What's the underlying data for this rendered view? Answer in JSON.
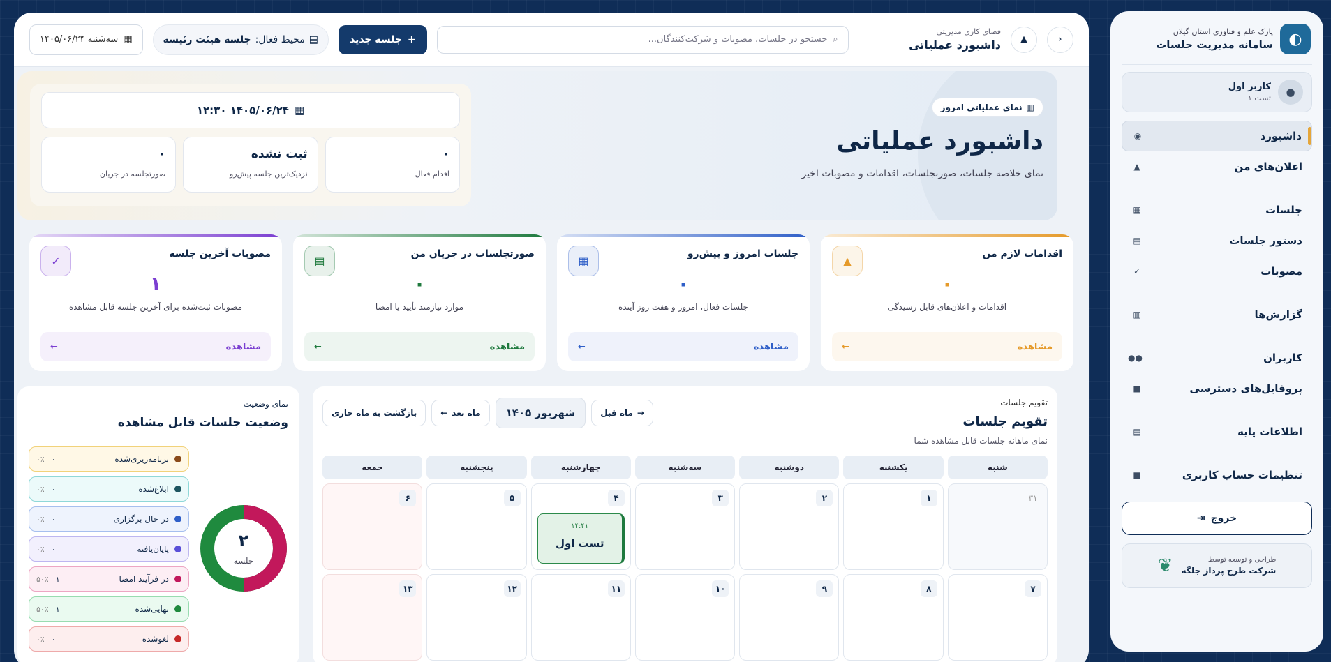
{
  "sidebar": {
    "brand_sub": "پارک علم و فناوری استان گیلان",
    "brand_title": "سامانه مدیریت جلسات",
    "user_name": "کاربر اول",
    "user_sub": "تست ۱",
    "items": [
      {
        "label": "داشبورد",
        "icon": "eye-icon"
      },
      {
        "label": "اعلان‌های من",
        "icon": "bell-icon"
      },
      {
        "label": "جلسات",
        "icon": "calendar-icon"
      },
      {
        "label": "دستور جلسات",
        "icon": "document-icon"
      },
      {
        "label": "مصوبات",
        "icon": "check-icon"
      },
      {
        "label": "گزارش‌ها",
        "icon": "chart-icon"
      },
      {
        "label": "کاربران",
        "icon": "users-icon"
      },
      {
        "label": "پروفایل‌های دسترسی",
        "icon": "lock-icon"
      },
      {
        "label": "اطلاعات پایه",
        "icon": "document-icon"
      },
      {
        "label": "تنظیمات حساب کاربری",
        "icon": "lock-icon"
      }
    ],
    "logout_label": "خروج",
    "dev_sub": "طراحی و توسعه توسط",
    "dev_title": "شرکت طرح پرداز جلگه"
  },
  "topbar": {
    "ws_sub": "فضای کاری مدیریتی",
    "ws_title": "داشبورد عملیاتی",
    "search_placeholder": "جستجو در جلسات، مصوبات و شرکت‌کنندگان...",
    "new_button": "جلسه جدید",
    "env_label": "محیط فعال:",
    "env_value": "جلسه هیئت رئیسه",
    "date": "سه‌شنبه ۱۴۰۵/۰۶/۲۴"
  },
  "hero": {
    "pill": "نمای عملیاتی امروز",
    "title": "داشبورد عملیاتی",
    "desc": "نمای خلاصه جلسات، صورتجلسات، اقدامات و مصوبات اخیر",
    "datetime": "۱۴۰۵/۰۶/۲۴ ۱۲:۳۰",
    "stats": [
      {
        "value": "۰",
        "label": "اقدام فعال"
      },
      {
        "value": "ثبت نشده",
        "label": "نزدیک‌ترین جلسه پیش‌رو"
      },
      {
        "value": "۰",
        "label": "صورتجلسه در جریان"
      }
    ]
  },
  "cards": [
    {
      "title": "اقدامات لازم من",
      "value": "۰",
      "desc": "اقدامات و اعلان‌های قابل رسیدگی",
      "link": "مشاهده",
      "color": "#e59a2a",
      "icon": "bell-icon"
    },
    {
      "title": "جلسات امروز و پیش‌رو",
      "value": "۰",
      "desc": "جلسات فعال، امروز و هفت روز آینده",
      "link": "مشاهده",
      "color": "#2f5fc8",
      "icon": "calendar-icon"
    },
    {
      "title": "صورتجلسات در جریان من",
      "value": "۰",
      "desc": "موارد نیازمند تأیید یا امضا",
      "link": "مشاهده",
      "color": "#1f7a3e",
      "icon": "document-icon"
    },
    {
      "title": "مصوبات آخرین جلسه",
      "value": "۱",
      "desc": "مصوبات ثبت‌شده برای آخرین جلسه قابل مشاهده",
      "link": "مشاهده",
      "color": "#7b3fd1",
      "icon": "check-icon"
    }
  ],
  "calendar": {
    "sub": "تقویم جلسات",
    "title": "تقویم جلسات",
    "desc": "نمای ماهانه جلسات قابل مشاهده شما",
    "prev": "ماه قبل",
    "month": "شهریور ۱۴۰۵",
    "next": "ماه بعد",
    "back": "بازگشت به ماه جاری",
    "weekdays": [
      "شنبه",
      "یکشنبه",
      "دوشنبه",
      "سه‌شنبه",
      "چهارشنبه",
      "پنجشنبه",
      "جمعه"
    ],
    "rows": [
      [
        "۳۱",
        "۱",
        "۲",
        "۳",
        "۴",
        "۵",
        "۶"
      ],
      [
        "۷",
        "۸",
        "۹",
        "۱۰",
        "۱۱",
        "۱۲",
        "۱۳"
      ]
    ],
    "event": {
      "time": "۱۴:۴۱",
      "title": "تست اول"
    }
  },
  "status": {
    "sub": "نمای وضعیت",
    "title": "وضعیت جلسات قابل مشاهده",
    "total": "۲",
    "total_label": "جلسه",
    "items": [
      {
        "label": "برنامه‌ریزی‌شده",
        "count": "۰",
        "pct": "۰٪",
        "color": "#8a4a1a",
        "bg": "#fff8e6",
        "border": "#f1d27a"
      },
      {
        "label": "ابلاغ‌شده",
        "count": "۰",
        "pct": "۰٪",
        "color": "#1d5560",
        "bg": "#ecfafa",
        "border": "#8fd8d8"
      },
      {
        "label": "در حال برگزاری",
        "count": "۰",
        "pct": "۰٪",
        "color": "#2f5fc8",
        "bg": "#eef3fd",
        "border": "#a6bfee"
      },
      {
        "label": "پایان‌یافته",
        "count": "۰",
        "pct": "۰٪",
        "color": "#5a4fd8",
        "bg": "#f2f0fd",
        "border": "#bdb6f0"
      },
      {
        "label": "در فرآیند امضا",
        "count": "۱",
        "pct": "۵۰٪",
        "color": "#c2185b",
        "bg": "#fdeef4",
        "border": "#eda6c3"
      },
      {
        "label": "نهایی‌شده",
        "count": "۱",
        "pct": "۵۰٪",
        "color": "#1f8a3e",
        "bg": "#eafaf0",
        "border": "#98dcb0"
      },
      {
        "label": "لغوشده",
        "count": "۰",
        "pct": "۰٪",
        "color": "#c62828",
        "bg": "#fdeeee",
        "border": "#eeaaaa"
      }
    ]
  }
}
